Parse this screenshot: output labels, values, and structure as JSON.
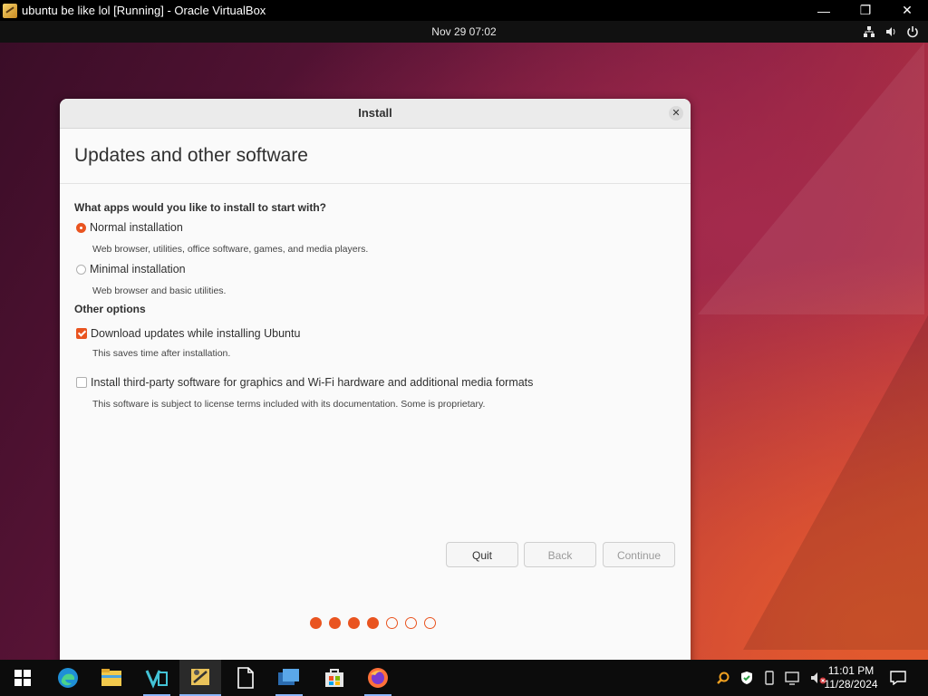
{
  "vbox": {
    "title": "ubuntu be like lol [Running] - Oracle VirtualBox",
    "minimize": "—",
    "restore": "❐",
    "close": "✕"
  },
  "ubuntu_panel": {
    "datetime": "Nov 29  07:02",
    "icons": [
      "network-icon",
      "volume-icon",
      "power-icon"
    ]
  },
  "dialog": {
    "title": "Install",
    "heading": "Updates and other software",
    "q1": "What apps would you like to install to start with?",
    "normal_label": "Normal installation",
    "normal_desc": "Web browser, utilities, office software, games, and media players.",
    "minimal_label": "Minimal installation",
    "minimal_desc": "Web browser and basic utilities.",
    "other_options": "Other options",
    "download_label": "Download updates while installing Ubuntu",
    "download_desc": "This saves time after installation.",
    "thirdparty_label": "Install third-party software for graphics and Wi-Fi hardware and additional media formats",
    "thirdparty_desc": "This software is subject to license terms included with its documentation. Some is proprietary.",
    "quit": "Quit",
    "back": "Back",
    "continue": "Continue",
    "selected_install_type": "normal",
    "download_updates_checked": true,
    "third_party_checked": false,
    "progress_steps_total": 7,
    "progress_steps_done": 4,
    "accent": "#e95420"
  },
  "taskbar": {
    "items": [
      "windows-start-icon",
      "edge-icon",
      "file-explorer-icon",
      "visual-studio-icon",
      "virtualbox-icon",
      "notepad-icon",
      "remote-desktop-icon",
      "store-icon",
      "firefox-icon"
    ],
    "time": "11:01 PM",
    "date": "11/28/2024"
  }
}
